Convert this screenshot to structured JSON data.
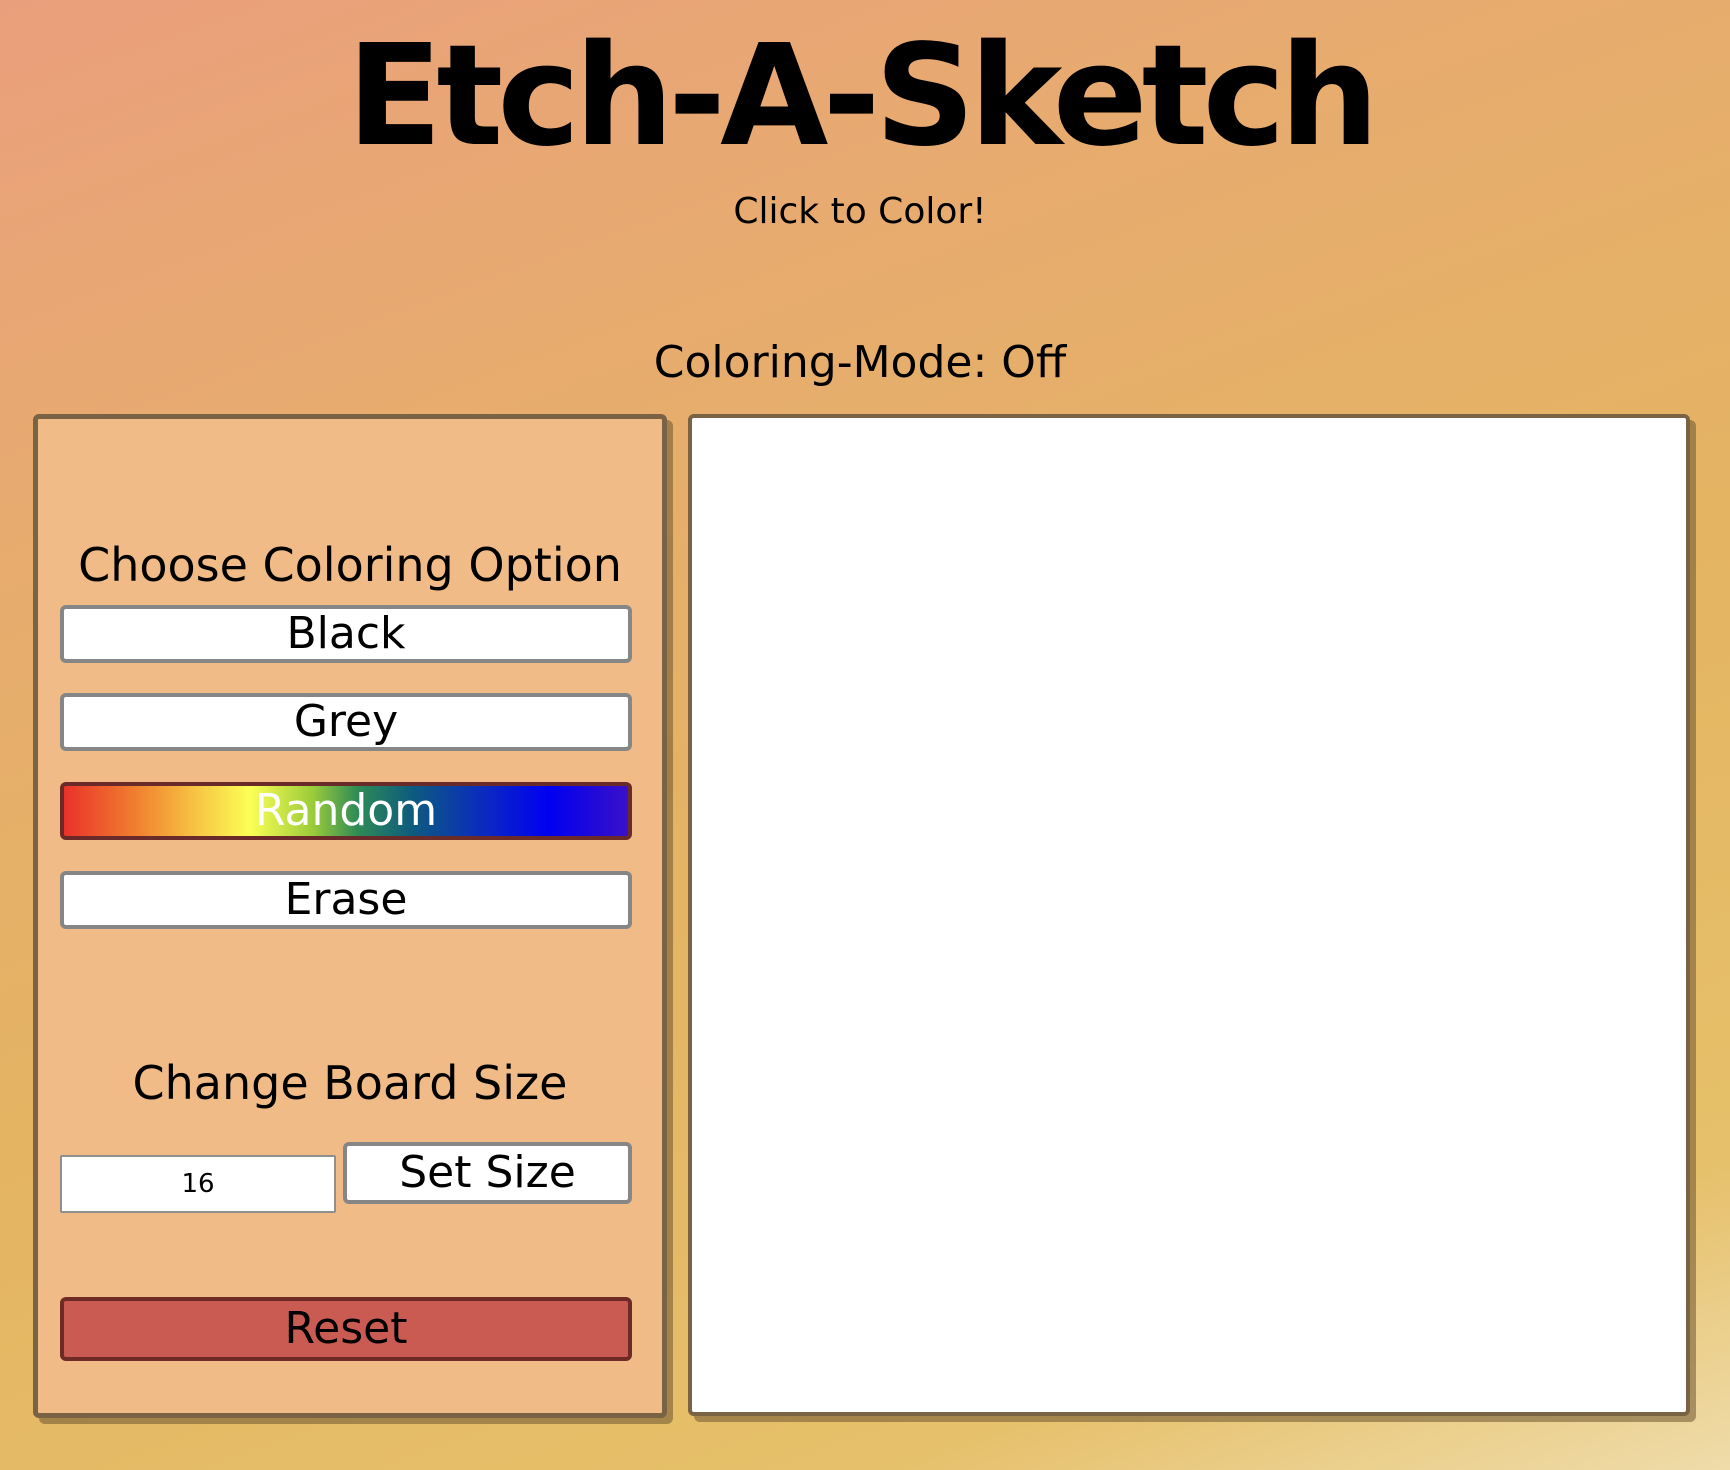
{
  "header": {
    "title": "Etch-A-Sketch",
    "subtitle": "Click to Color!"
  },
  "status": {
    "coloring_mode": "Coloring-Mode: Off"
  },
  "controls": {
    "coloring_title": "Choose Coloring Option",
    "options": [
      {
        "label": "Black"
      },
      {
        "label": "Grey"
      },
      {
        "label": "Random"
      },
      {
        "label": "Erase"
      }
    ],
    "board_size_title": "Change Board Size",
    "size_input_value": "16",
    "set_size_label": "Set Size",
    "reset_label": "Reset"
  },
  "colors": {
    "panel_background": "#f0bb86",
    "reset_button": "#c95b53",
    "board_background": "#ffffff"
  }
}
